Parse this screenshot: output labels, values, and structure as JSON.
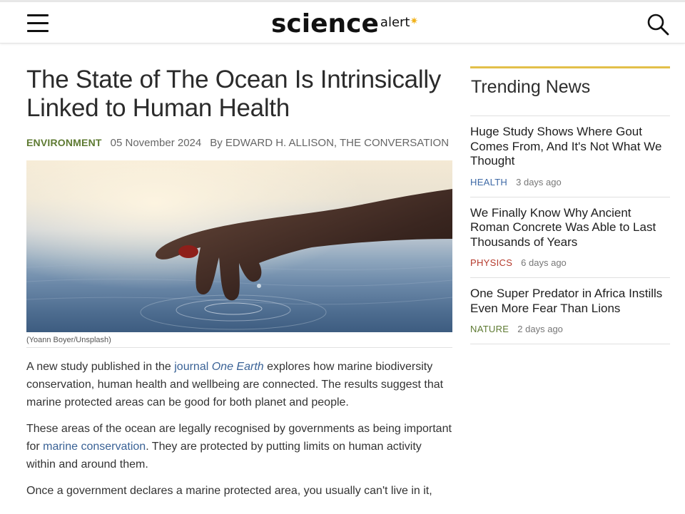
{
  "header": {
    "logo_main": "science",
    "logo_sub": "alert",
    "accent_color": "#f1b21a"
  },
  "article": {
    "title": "The State of The Ocean Is Intrinsically Linked to Human Health",
    "category": "ENVIRONMENT",
    "category_color": "#5e7a32",
    "date": "05 November 2024",
    "byline": "By EDWARD H. ALLISON, THE CONVERSATION",
    "image_caption": "(Yoann Boyer/Unsplash)",
    "paragraphs": {
      "p1_a": "A new study published in the ",
      "p1_link": "journal ",
      "p1_link_em": "One Earth",
      "p1_b": " explores how marine biodiversity conservation, human health and wellbeing are connected. The results suggest that marine protected areas can be good for both planet and people.",
      "p2_a": "These areas of the ocean are legally recognised by governments as being important for ",
      "p2_link": "marine conservation",
      "p2_b": ". They are protected by putting limits on human activity within and around them.",
      "p3": "Once a government declares a marine protected area, you usually can't live in it,"
    }
  },
  "trending": {
    "heading": "Trending News",
    "items": [
      {
        "title": "Huge Study Shows Where Gout Comes From, And It's Not What We Thought",
        "category": "HEALTH",
        "category_color": "#3f6aa6",
        "time": "3 days ago"
      },
      {
        "title": "We Finally Know Why Ancient Roman Concrete Was Able to Last Thousands of Years",
        "category": "PHYSICS",
        "category_color": "#b53a2c",
        "time": "6 days ago"
      },
      {
        "title": "One Super Predator in Africa Instills Even More Fear Than Lions",
        "category": "NATURE",
        "category_color": "#5e7a32",
        "time": "2 days ago"
      }
    ]
  }
}
